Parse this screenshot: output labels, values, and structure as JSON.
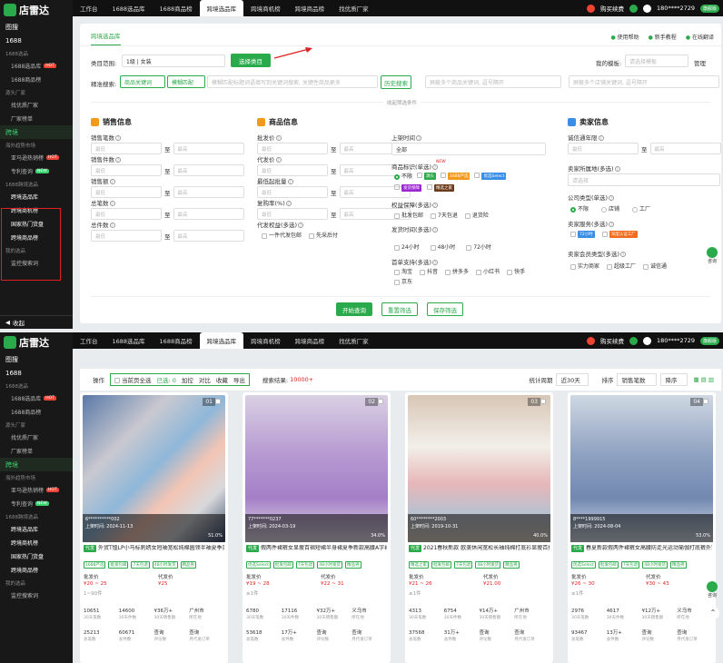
{
  "logo": "店雷达",
  "sidebar": {
    "items": [
      {
        "label": "图搜",
        "cls": "head"
      },
      {
        "label": "1688",
        "cls": "head"
      },
      {
        "label": "1688选品",
        "cls": "sec"
      },
      {
        "label": "1688选品库",
        "cls": "sub",
        "tag": "HOT",
        "tagcls": "hot"
      },
      {
        "label": "1688商品榜",
        "cls": "sub"
      },
      {
        "label": "源头厂家",
        "cls": "sec"
      },
      {
        "label": "找优质厂家",
        "cls": "sub"
      },
      {
        "label": "厂家榜单",
        "cls": "sub"
      },
      {
        "label": "跨境",
        "cls": "head active-grp"
      },
      {
        "label": "海外趋势市场",
        "cls": "sec"
      },
      {
        "label": "亚马逊热销榜",
        "cls": "sub",
        "tag": "HOT",
        "tagcls": "hot"
      },
      {
        "label": "专利查询",
        "cls": "sub",
        "tag": "NEW",
        "tagcls": "new"
      },
      {
        "label": "1688跨境选品",
        "cls": "sec"
      },
      {
        "label": "跨境选品库",
        "cls": "sub white"
      },
      {
        "label": "跨境商机榜",
        "cls": "sub white"
      },
      {
        "label": "国家热门货盘",
        "cls": "sub white"
      },
      {
        "label": "跨境商品榜",
        "cls": "sub white"
      },
      {
        "label": "我的选品",
        "cls": "sec"
      },
      {
        "label": "监控搜索词",
        "cls": "sub"
      }
    ],
    "collapse": "收起"
  },
  "tabs": [
    "工作台",
    "1688选品库",
    "1688商品榜",
    "跨境选品库",
    "跨境商机榜",
    "跨境商品榜",
    "找优质厂家"
  ],
  "topbar": {
    "buy": "购买续费",
    "user": "180****2729",
    "vip": "旗舰版"
  },
  "page": {
    "tab": "跨境选品库",
    "links": [
      "使用帮助",
      "新手教程",
      "在线翻译"
    ],
    "category_label": "类目范围:",
    "category_value": "1级 | 女装",
    "choose_btn": "选择类目",
    "template_label": "我的模板:",
    "template_ph": "请选择模板",
    "manage": "管理",
    "search_label": "精准搜索:",
    "kw_select": "商品关键词",
    "match_select": "模糊匹配",
    "kw_ph": "模糊匹配标题词语填写到关键词搜索, 关键性商品更多",
    "history": "历史搜索",
    "kw2_ph": "屏蔽多个商品关键词, 逗号隔开",
    "kw3_ph": "屏蔽多个店铺关键词, 逗号隔开",
    "collapse": "收起筛选条件",
    "sections": [
      "销售信息",
      "商品信息",
      "卖家信息"
    ],
    "sales_fields": [
      "销售笔数",
      "销售件数",
      "销售额",
      "总笔数",
      "总件数"
    ],
    "goods_fields": [
      "批发价",
      "代发价",
      "最低起批量",
      "复购率(%)",
      "代发权益(多选)"
    ],
    "goods_opts": [
      "一件代发包邮",
      "先采后付"
    ],
    "mid_fields": [
      "上架时间",
      "商品标识(单选)",
      "权益保障(多选)",
      "发货时间(多选)",
      "首单支持(多选)"
    ],
    "listing_all": "全部",
    "mark_opts": [
      "不限",
      "源头",
      "1688严选",
      "优选Select",
      "发货保障",
      "精选之家"
    ],
    "right_opts": [
      "批发包邮",
      "7天包退",
      "退货险"
    ],
    "ship_opts": [
      "24小时",
      "48小时",
      "72小时"
    ],
    "first_opts": [
      "淘宝",
      "抖音",
      "拼多多",
      "小红书",
      "快手",
      "京东"
    ],
    "seller_fields": [
      "诚信通年限",
      "卖家所属地(多选)",
      "公司类型(单选)",
      "卖家服务(多选)",
      "卖家会员类型(多选)"
    ],
    "seller_region_ph": "请选择",
    "company_opts": [
      "不限",
      "店铺",
      "工厂"
    ],
    "service_opts": [
      "72小时",
      "深度认证工厂"
    ],
    "member_opts": [
      "实力商家",
      "超级工厂",
      "诚信通"
    ],
    "min": "最低",
    "max": "最高",
    "to": "至",
    "btn_query": "开始查询",
    "btn_reset": "重置筛选",
    "btn_save": "保存筛选",
    "float_label": "咨询"
  },
  "toolbar": {
    "op": "操作",
    "select_page": "当前页全选",
    "selected": "已选: 0",
    "actions": [
      "加控",
      "对比",
      "收藏",
      "导出"
    ],
    "result_label": "搜索结果:",
    "result_val": "10000+",
    "period_label": "统计周期",
    "period_val": "近30天",
    "sort_label": "排序",
    "sort_val": "销售笔数",
    "order": "降序"
  },
  "cards": [
    {
      "num": "01",
      "id": "6**********002",
      "date": "上架时间: 2024-11-13",
      "title": "外贸T恤LP小马标刺绣女短袖宽松纯棉圆领半袖夏季百搭上衣",
      "labels": [
        "1688严选",
        "批发包邮",
        "7天包退",
        "48小时发货",
        "精品男"
      ],
      "price": "¥20 ~ 25",
      "price_label": "批发价",
      "dprice": "¥25",
      "dprice_label": "代发价",
      "minbuy": "1~90件",
      "s1": [
        "10651",
        "30天笔数"
      ],
      "s2": [
        "14600",
        "30天件数"
      ],
      "s3": [
        "¥36万+",
        "30天销售额"
      ],
      "s4": [
        "广州市",
        "所在地"
      ],
      "t1": [
        "25213",
        "总笔数"
      ],
      "t2": [
        "60671",
        "总件数"
      ],
      "t3": [
        "查询",
        "评论数"
      ],
      "t4": [
        "查询",
        "月代发订单"
      ],
      "rate": "51.0%"
    },
    {
      "num": "02",
      "id": "77*******0237",
      "date": "上架时间: 2024-03-19",
      "title": "假两件裙裤女显瘦百褶短裙半身裙夏季新款高腰A字裙防走光裤裙",
      "labels": [
        "优选Select",
        "批发包邮",
        "7天包退",
        "48小时发货",
        "精品男"
      ],
      "price": "¥19 ~ 28",
      "price_label": "批发价",
      "dprice": "¥22 ~ 31",
      "dprice_label": "代发价",
      "minbuy": "≥1件",
      "s1": [
        "6780",
        "30天笔数"
      ],
      "s2": [
        "17116",
        "30天件数"
      ],
      "s3": [
        "¥32万+",
        "30天销售额"
      ],
      "s4": [
        "义乌市",
        "所在地"
      ],
      "t1": [
        "53618",
        "总笔数"
      ],
      "t2": [
        "17万+",
        "总件数"
      ],
      "t3": [
        "查询",
        "评论数"
      ],
      "t4": [
        "查询",
        "月代发订单"
      ],
      "rate": "34.0%"
    },
    {
      "num": "03",
      "id": "60********2003",
      "date": "上架时间: 2019-10-31",
      "title": "2021春秋新款 欧美休闲宽松长袖纯棉打底衫显瘦百搭上衣女",
      "labels": [
        "精选之家",
        "批发包邮",
        "7天包退",
        "48小时发货",
        "精品男"
      ],
      "price": "¥21 ~ 26",
      "price_label": "批发价",
      "dprice": "¥21.00",
      "dprice_label": "代发价",
      "minbuy": "≥1件",
      "s1": [
        "4313",
        "30天笔数"
      ],
      "s2": [
        "6754",
        "30天件数"
      ],
      "s3": [
        "¥14万+",
        "30天销售额"
      ],
      "s4": [
        "广州市",
        "所在地"
      ],
      "t1": [
        "37568",
        "总笔数"
      ],
      "t2": [
        "31万+",
        "总件数"
      ],
      "t3": [
        "查询",
        "评论数"
      ],
      "t4": [
        "查询",
        "月代发订单"
      ],
      "rate": "40.0%"
    },
    {
      "num": "04",
      "id": "8****1999915",
      "date": "上架时间: 2024-08-04",
      "title": "春夏新款假两件裙裤女高腰防走光运动瑜伽打底裤外穿显瘦",
      "labels": [
        "优选Select",
        "批发包邮",
        "7天包退",
        "48小时发货",
        "精品男"
      ],
      "price": "¥26 ~ 30",
      "price_label": "批发价",
      "dprice": "¥30 ~ 43",
      "dprice_label": "代发价",
      "minbuy": "≥1件",
      "s1": [
        "2976",
        "30天笔数"
      ],
      "s2": [
        "4617",
        "30天件数"
      ],
      "s3": [
        "¥12万+",
        "30天销售额"
      ],
      "s4": [
        "义乌市",
        "所在地"
      ],
      "t1": [
        "93467",
        "总笔数"
      ],
      "t2": [
        "13万+",
        "总件数"
      ],
      "t3": [
        "查询",
        "评论数"
      ],
      "t4": [
        "查询",
        "月代发订单"
      ],
      "rate": "53.0%"
    }
  ]
}
